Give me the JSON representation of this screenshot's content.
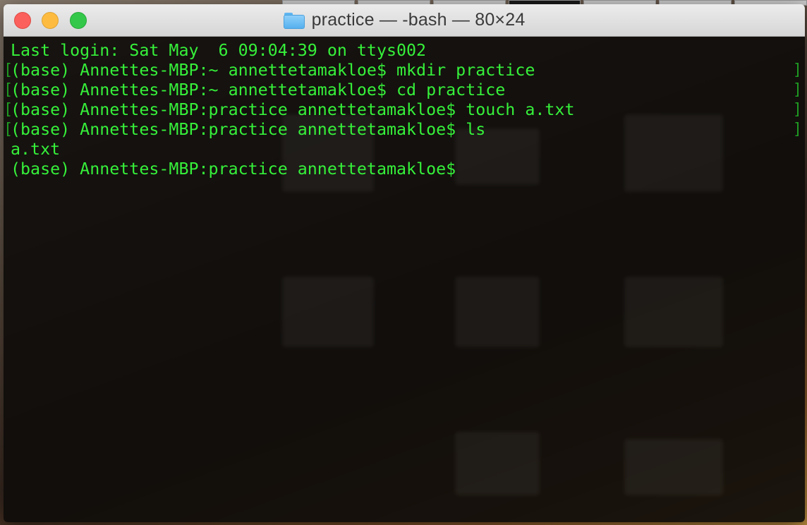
{
  "window": {
    "title": "practice — -bash — 80×24",
    "folder_icon": "folder-icon"
  },
  "colors": {
    "terminal_text": "#36f03a",
    "terminal_background": "#0e0c0a",
    "close": "#fc605c",
    "minimize": "#fdbc40",
    "zoom": "#34c84a"
  },
  "terminal": {
    "lines": [
      {
        "text": "Last login: Sat May  6 09:04:39 on ttys002",
        "marked": false
      },
      {
        "text": "(base) Annettes-MBP:~ annettetamakloe$ mkdir practice",
        "marked": true
      },
      {
        "text": "(base) Annettes-MBP:~ annettetamakloe$ cd practice",
        "marked": true
      },
      {
        "text": "(base) Annettes-MBP:practice annettetamakloe$ touch a.txt",
        "marked": true
      },
      {
        "text": "(base) Annettes-MBP:practice annettetamakloe$ ls",
        "marked": true
      },
      {
        "text": "a.txt",
        "marked": false
      },
      {
        "text": "(base) Annettes-MBP:practice annettetamakloe$",
        "marked": false
      }
    ],
    "mark_open": "[",
    "mark_close": "]"
  }
}
